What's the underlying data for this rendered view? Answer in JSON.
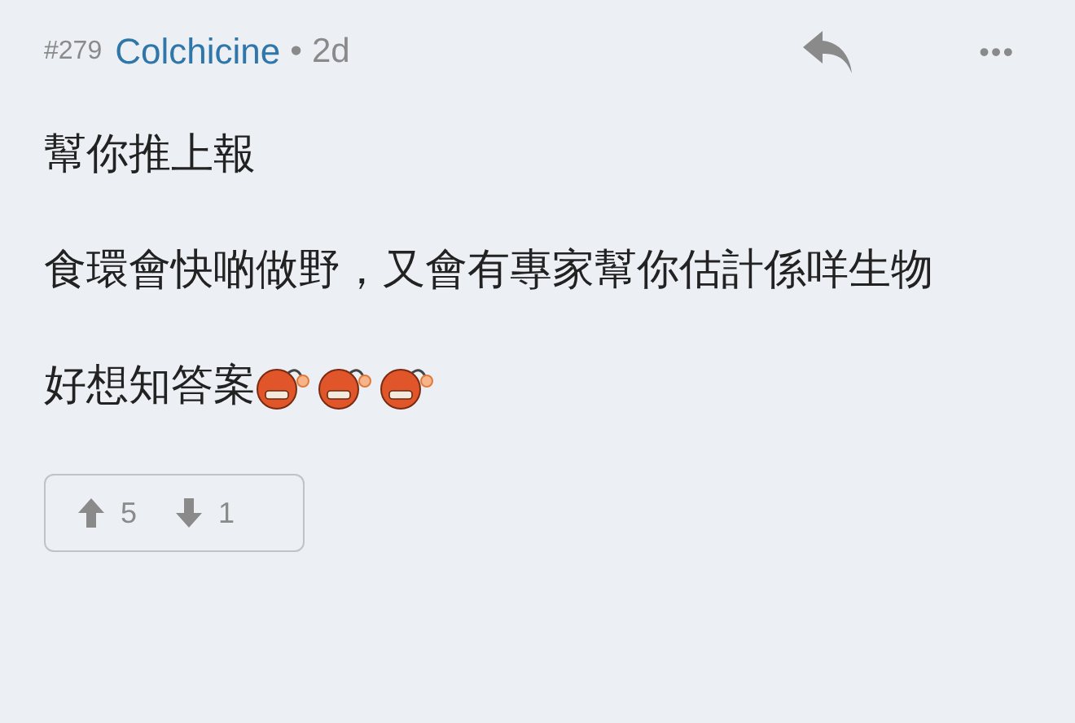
{
  "post": {
    "number": "#279",
    "author": "Colchicine",
    "separator": "•",
    "age": "2d",
    "more": "•••",
    "paragraphs": [
      {
        "kind": "plain",
        "text": "幫你推上報"
      },
      {
        "kind": "plain",
        "text": "食環會快啲做野，又會有專家幫你估計係咩生物"
      },
      {
        "kind": "emoji",
        "text": "好想知答案"
      }
    ],
    "votes": {
      "up": "5",
      "down": "1"
    }
  }
}
